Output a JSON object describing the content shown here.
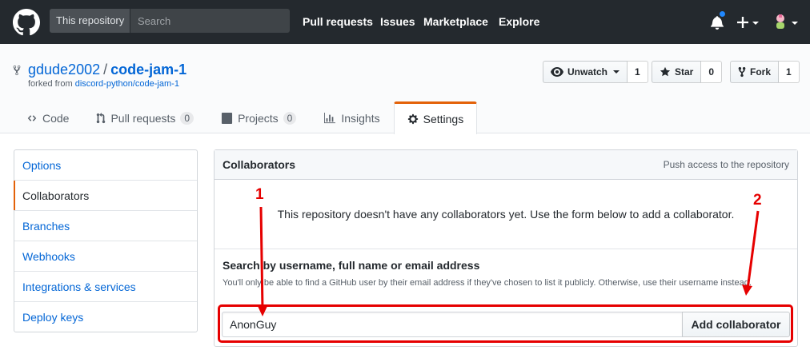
{
  "header": {
    "search_scope": "This repository",
    "search_placeholder": "Search",
    "nav": [
      "Pull requests",
      "Issues",
      "Marketplace",
      "Explore"
    ],
    "notification_color": "#2188ff"
  },
  "repo": {
    "owner": "gdude2002",
    "separator": "/",
    "name": "code-jam-1",
    "forked_prefix": "forked from",
    "forked_source": "discord-python/code-jam-1",
    "actions": {
      "watch_label": "Unwatch",
      "watch_count": "1",
      "star_label": "Star",
      "star_count": "0",
      "fork_label": "Fork",
      "fork_count": "1"
    }
  },
  "tabs": {
    "code": "Code",
    "pulls": "Pull requests",
    "pulls_count": "0",
    "projects": "Projects",
    "projects_count": "0",
    "insights": "Insights",
    "settings": "Settings"
  },
  "sidebar": {
    "items": [
      {
        "label": "Options"
      },
      {
        "label": "Collaborators"
      },
      {
        "label": "Branches"
      },
      {
        "label": "Webhooks"
      },
      {
        "label": "Integrations & services"
      },
      {
        "label": "Deploy keys"
      }
    ],
    "selected": "Collaborators"
  },
  "collaborators": {
    "title": "Collaborators",
    "meta": "Push access to the repository",
    "blank_message": "This repository doesn't have any collaborators yet. Use the form below to add a collaborator.",
    "form_label": "Search by username, full name or email address",
    "form_note": "You'll only be able to find a GitHub user by their email address if they've chosen to list it publicly. Otherwise, use their username instead.",
    "input_value": "AnonGuy",
    "add_button": "Add collaborator"
  },
  "annotations": {
    "marker_1": "1",
    "marker_2": "2",
    "color": "#e60000"
  }
}
